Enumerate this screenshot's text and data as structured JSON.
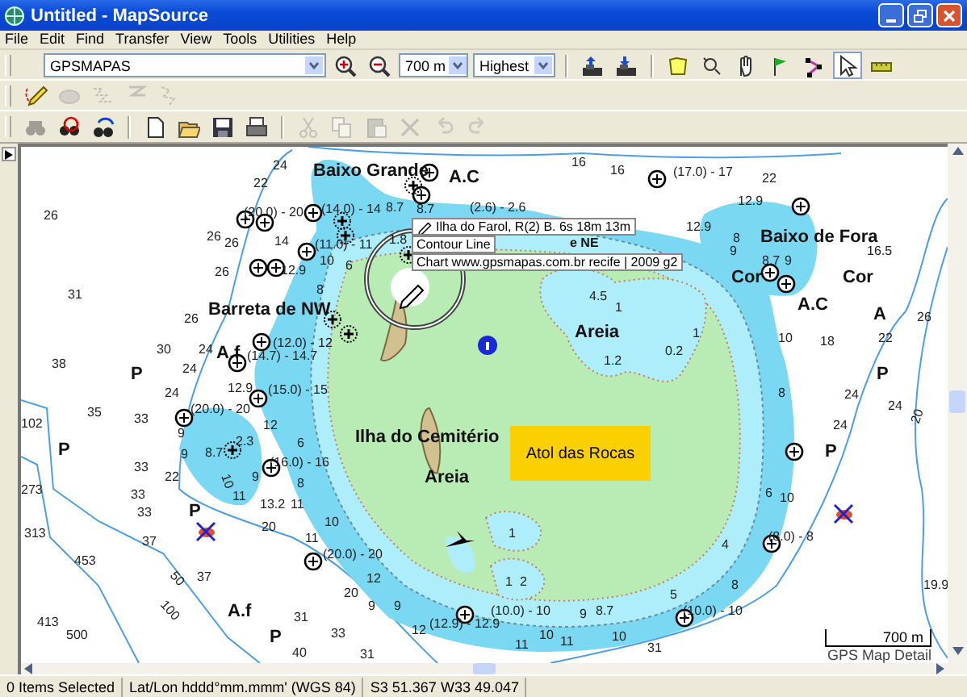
{
  "window": {
    "title": "Untitled - MapSource"
  },
  "menu": [
    "File",
    "Edit",
    "Find",
    "Transfer",
    "View",
    "Tools",
    "Utilities",
    "Help"
  ],
  "toolbar": {
    "product": "GPSMAPAS",
    "zoom": "700 m",
    "detail": "Highest",
    "zoom_buttons": [
      {
        "kind": "zoomin"
      },
      {
        "kind": "zoomout"
      }
    ],
    "device_buttons": [
      {
        "kind": "send"
      },
      {
        "kind": "receive"
      }
    ],
    "tools": [
      {
        "kind": "map",
        "selected": false
      },
      {
        "kind": "zoom",
        "selected": false
      },
      {
        "kind": "hand",
        "selected": false
      },
      {
        "kind": "flag",
        "selected": false
      },
      {
        "kind": "route",
        "selected": false
      },
      {
        "kind": "pointer",
        "selected": true
      },
      {
        "kind": "ruler",
        "selected": false
      }
    ],
    "draw_tools": [
      {
        "kind": "pencil",
        "disabled": false
      },
      {
        "kind": "eraser",
        "disabled": true
      },
      {
        "kind": "track",
        "disabled": true
      },
      {
        "kind": "routeline",
        "disabled": true
      },
      {
        "kind": "trackline",
        "disabled": true
      }
    ],
    "edit_tools": [
      {
        "kind": "binoculars",
        "disabled": true
      },
      {
        "kind": "findwaypoint",
        "disabled": false
      },
      {
        "kind": "findnearby",
        "disabled": false
      },
      {
        "kind": "sep"
      },
      {
        "kind": "new",
        "disabled": false
      },
      {
        "kind": "open",
        "disabled": false
      },
      {
        "kind": "save",
        "disabled": false
      },
      {
        "kind": "print",
        "disabled": false
      },
      {
        "kind": "sep"
      },
      {
        "kind": "cut",
        "disabled": true
      },
      {
        "kind": "copy",
        "disabled": true
      },
      {
        "kind": "paste",
        "disabled": true
      },
      {
        "kind": "delete",
        "disabled": true
      },
      {
        "kind": "undo",
        "disabled": true
      },
      {
        "kind": "redo",
        "disabled": true
      }
    ]
  },
  "map": {
    "labels": [
      {
        "text": "Baixo Grande",
        "kind": "place"
      },
      {
        "text": "A.C",
        "kind": "place"
      },
      {
        "text": "Barreta de NW",
        "kind": "place"
      },
      {
        "text": "Ilha do Cemitério",
        "kind": "place"
      },
      {
        "text": "Areia",
        "kind": "place"
      },
      {
        "text": "Areia",
        "kind": "place"
      },
      {
        "text": "A.f",
        "kind": "place"
      },
      {
        "text": "A.f",
        "kind": "place"
      },
      {
        "text": "Baixo de Fora",
        "kind": "place"
      },
      {
        "text": "Cor",
        "kind": "place"
      },
      {
        "text": "Cor",
        "kind": "place"
      },
      {
        "text": "A.C",
        "kind": "place"
      },
      {
        "text": "A",
        "kind": "place"
      },
      {
        "text": "e NE",
        "kind": "place"
      },
      {
        "text": "P",
        "kind": "place"
      },
      {
        "text": "P",
        "kind": "place"
      },
      {
        "text": "P",
        "kind": "place"
      },
      {
        "text": "P",
        "kind": "place"
      },
      {
        "text": "P",
        "kind": "place"
      },
      {
        "text": "P",
        "kind": "place"
      },
      {
        "text": "24",
        "kind": "depth"
      },
      {
        "text": "22",
        "kind": "depth"
      },
      {
        "text": "26",
        "kind": "depth"
      },
      {
        "text": "26",
        "kind": "depth"
      },
      {
        "text": "26",
        "kind": "depth"
      },
      {
        "text": "26",
        "kind": "depth"
      },
      {
        "text": "31",
        "kind": "depth"
      },
      {
        "text": "26",
        "kind": "depth"
      },
      {
        "text": "30",
        "kind": "depth"
      },
      {
        "text": "24",
        "kind": "depth"
      },
      {
        "text": "38",
        "kind": "depth"
      },
      {
        "text": "24",
        "kind": "depth"
      },
      {
        "text": "24",
        "kind": "depth"
      },
      {
        "text": "35",
        "kind": "depth"
      },
      {
        "text": "33",
        "kind": "depth"
      },
      {
        "text": "102",
        "kind": "depth"
      },
      {
        "text": "33",
        "kind": "depth"
      },
      {
        "text": "22",
        "kind": "depth"
      },
      {
        "text": "33",
        "kind": "depth"
      },
      {
        "text": "33",
        "kind": "depth"
      },
      {
        "text": "37",
        "kind": "depth"
      },
      {
        "text": "453",
        "kind": "depth"
      },
      {
        "text": "37",
        "kind": "depth"
      },
      {
        "text": "413",
        "kind": "depth"
      },
      {
        "text": "31",
        "kind": "depth"
      },
      {
        "text": "273",
        "kind": "depth"
      },
      {
        "text": "313",
        "kind": "depth"
      },
      {
        "text": "11",
        "kind": "depth"
      },
      {
        "text": "13.2",
        "kind": "depth"
      },
      {
        "text": "11",
        "kind": "depth"
      },
      {
        "text": "20",
        "kind": "depth"
      },
      {
        "text": "11",
        "kind": "depth"
      },
      {
        "text": "20",
        "kind": "depth"
      },
      {
        "text": "12",
        "kind": "depth"
      },
      {
        "text": "9",
        "kind": "depth"
      },
      {
        "text": "9",
        "kind": "depth"
      },
      {
        "text": "12",
        "kind": "depth"
      },
      {
        "text": "14",
        "kind": "depth"
      },
      {
        "text": "10",
        "kind": "depth"
      },
      {
        "text": "6",
        "kind": "depth"
      },
      {
        "text": "8",
        "kind": "depth"
      },
      {
        "text": "12.9",
        "kind": "depth"
      },
      {
        "text": "12.9",
        "kind": "depth"
      },
      {
        "text": "12",
        "kind": "depth"
      },
      {
        "text": "6",
        "kind": "depth"
      },
      {
        "text": "8",
        "kind": "depth"
      },
      {
        "text": "10",
        "kind": "depth"
      },
      {
        "text": "9",
        "kind": "depth"
      },
      {
        "text": "9",
        "kind": "depth"
      },
      {
        "text": "8.7",
        "kind": "depth"
      },
      {
        "text": "9",
        "kind": "depth"
      },
      {
        "text": "2.3",
        "kind": "depth"
      },
      {
        "text": "16",
        "kind": "depth"
      },
      {
        "text": "16",
        "kind": "depth"
      },
      {
        "text": "22",
        "kind": "depth"
      },
      {
        "text": "12.9",
        "kind": "depth"
      },
      {
        "text": "12.9",
        "kind": "depth"
      },
      {
        "text": "8.7",
        "kind": "depth"
      },
      {
        "text": "8.7",
        "kind": "depth"
      },
      {
        "text": "8",
        "kind": "depth"
      },
      {
        "text": "9",
        "kind": "depth"
      },
      {
        "text": "8.7",
        "kind": "depth"
      },
      {
        "text": "9",
        "kind": "depth"
      },
      {
        "text": "16.5",
        "kind": "depth"
      },
      {
        "text": "1.8",
        "kind": "depth"
      },
      {
        "text": "10",
        "kind": "depth"
      },
      {
        "text": "18",
        "kind": "depth"
      },
      {
        "text": "22",
        "kind": "depth"
      },
      {
        "text": "26",
        "kind": "depth"
      },
      {
        "text": "24",
        "kind": "depth"
      },
      {
        "text": "24",
        "kind": "depth"
      },
      {
        "text": "24",
        "kind": "depth"
      },
      {
        "text": "8",
        "kind": "depth"
      },
      {
        "text": "6",
        "kind": "depth"
      },
      {
        "text": "10",
        "kind": "depth"
      },
      {
        "text": "4",
        "kind": "depth"
      },
      {
        "text": "8",
        "kind": "depth"
      },
      {
        "text": "5",
        "kind": "depth"
      },
      {
        "text": "9",
        "kind": "depth"
      },
      {
        "text": "8.7",
        "kind": "depth"
      },
      {
        "text": "10",
        "kind": "depth"
      },
      {
        "text": "11",
        "kind": "depth"
      },
      {
        "text": "10",
        "kind": "depth"
      },
      {
        "text": "11",
        "kind": "depth"
      },
      {
        "text": "19.9",
        "kind": "depth"
      },
      {
        "text": "1",
        "kind": "depth"
      },
      {
        "text": "1.2",
        "kind": "depth"
      },
      {
        "text": "0.2",
        "kind": "depth"
      },
      {
        "text": "1",
        "kind": "depth"
      },
      {
        "text": "4.5",
        "kind": "depth"
      },
      {
        "text": "1",
        "kind": "depth"
      },
      {
        "text": "1",
        "kind": "depth"
      },
      {
        "text": "2",
        "kind": "depth"
      },
      {
        "text": "31",
        "kind": "depth"
      },
      {
        "text": "(20.0) - 20",
        "kind": "range"
      },
      {
        "text": "(14.0) - 14",
        "kind": "range"
      },
      {
        "text": "(11.0) - 11",
        "kind": "range"
      },
      {
        "text": "(12.0) - 12",
        "kind": "range"
      },
      {
        "text": "(14.7) - 14.7",
        "kind": "range"
      },
      {
        "text": "(15.0) - 15",
        "kind": "range"
      },
      {
        "text": "(20.0) - 20",
        "kind": "range"
      },
      {
        "text": "(16.0) - 16",
        "kind": "range"
      },
      {
        "text": "(20.0) - 20",
        "kind": "range"
      },
      {
        "text": "(17.0) - 17",
        "kind": "range"
      },
      {
        "text": "(2.6) - 2.6",
        "kind": "range"
      },
      {
        "text": "(8.0) - 8",
        "kind": "range"
      },
      {
        "text": "(10.0) - 10",
        "kind": "range"
      },
      {
        "text": "(10.0) - 10",
        "kind": "range"
      },
      {
        "text": "(12.9) - 12.9",
        "kind": "range"
      },
      {
        "text": "50",
        "kind": "contour"
      },
      {
        "text": "100",
        "kind": "contour"
      },
      {
        "text": "500",
        "kind": "contour"
      },
      {
        "text": "20",
        "kind": "contour"
      },
      {
        "text": "10",
        "kind": "contour"
      },
      {
        "text": "33",
        "kind": "depth"
      },
      {
        "text": "40",
        "kind": "depth"
      },
      {
        "text": "31",
        "kind": "depth"
      }
    ],
    "area_label": "Atol das Rocas",
    "tooltip": [
      "Ilha do Farol, R(2) B. 6s 18m 13m",
      "Contour Line",
      "Chart www.gpsmapas.com.br recife | 2009 g2"
    ],
    "scale": "700 m",
    "detail_label": "GPS Map Detail"
  },
  "status_bar": [
    "0 Items Selected",
    "Lat/Lon hddd°mm.mmm' (WGS 84)",
    "S3 51.367 W33 49.047"
  ]
}
